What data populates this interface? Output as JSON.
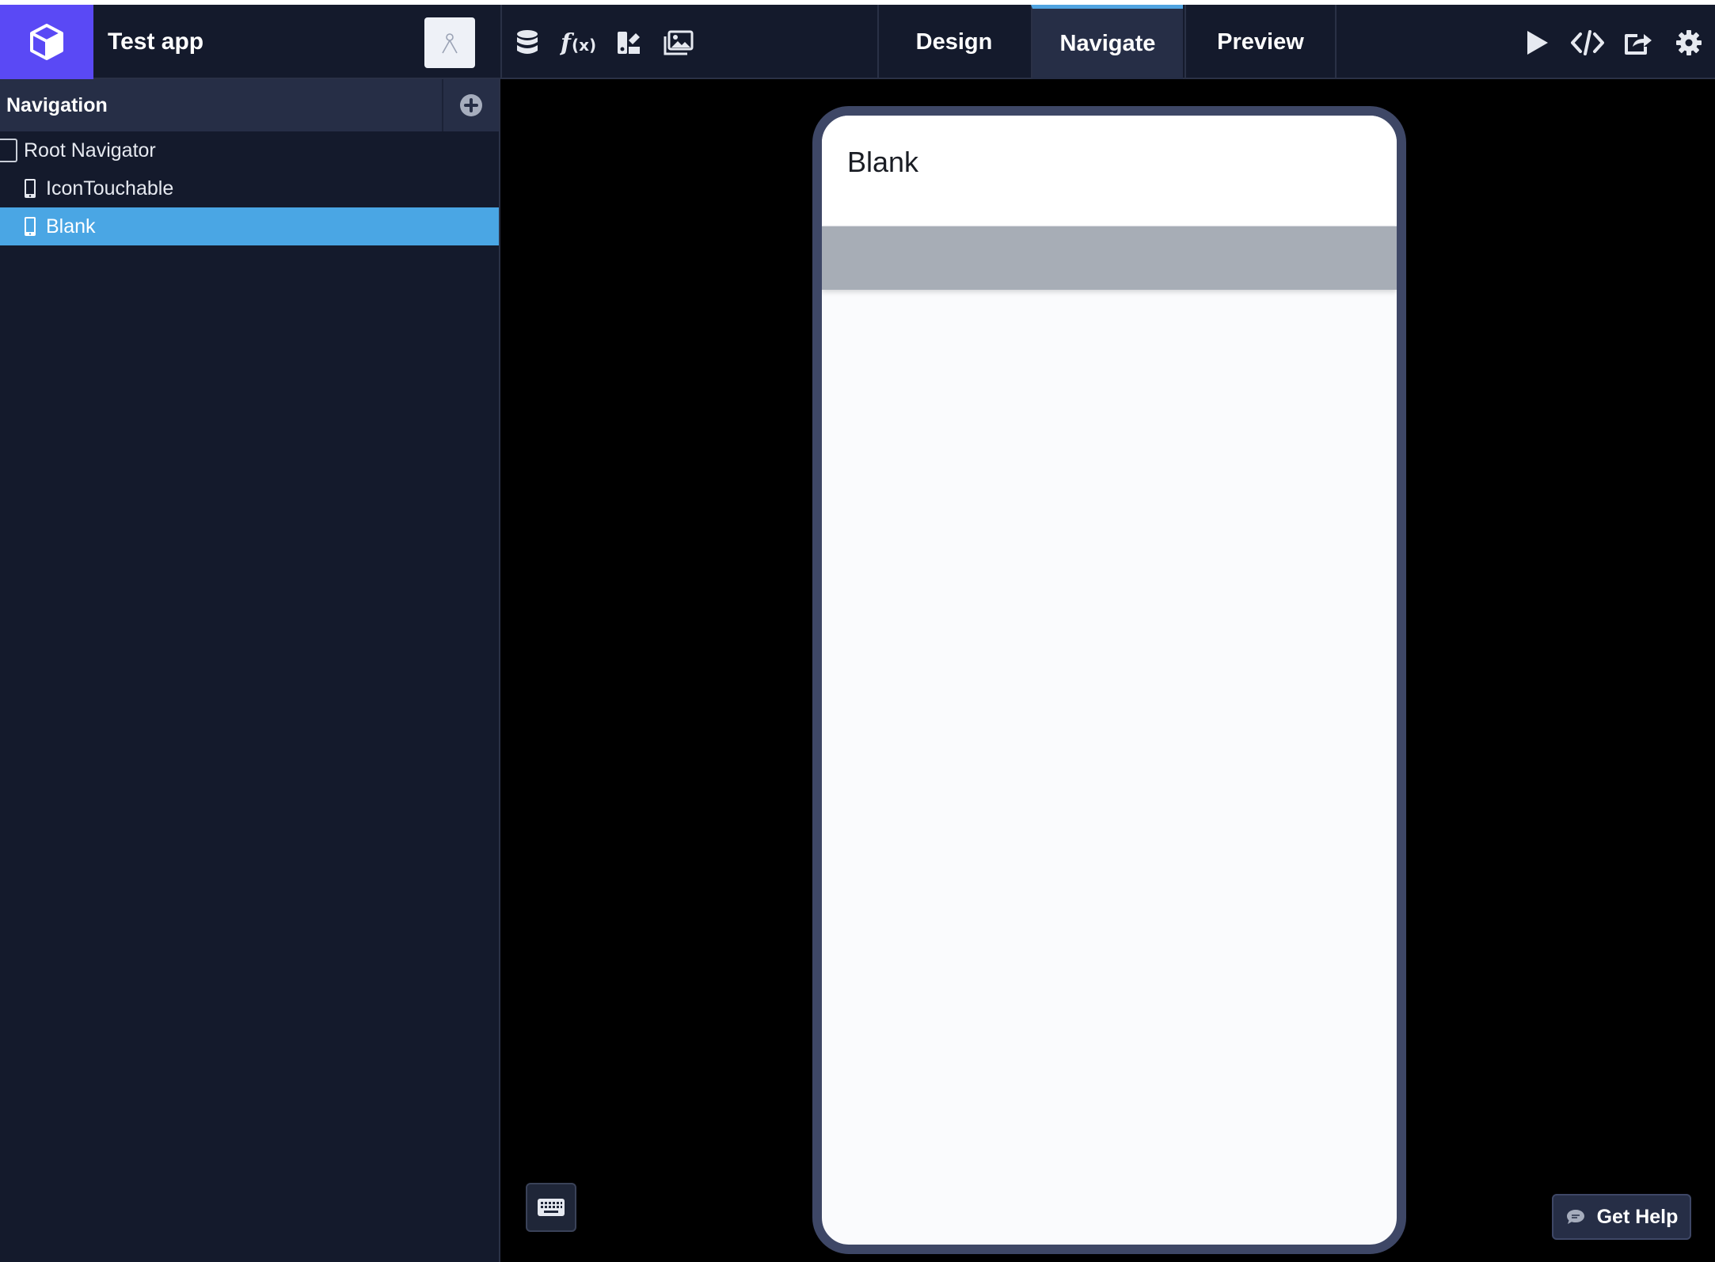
{
  "colors": {
    "brand": "#5a49f5",
    "header_bg": "#141a2c",
    "active_tab": "#262e46",
    "tab_accent": "#4fa3e0",
    "selected_row": "#4aa6e4",
    "canvas_bg": "#000000"
  },
  "header": {
    "logo_icon": "cube-icon",
    "app_title": "Test app",
    "user_icon": "user-avatar-icon",
    "tools": [
      {
        "name": "database-icon"
      },
      {
        "name": "function-icon"
      },
      {
        "name": "theme-icon"
      },
      {
        "name": "image-library-icon"
      }
    ],
    "tabs": [
      {
        "label": "Design",
        "active": false
      },
      {
        "label": "Navigate",
        "active": true
      },
      {
        "label": "Preview",
        "active": false
      }
    ],
    "actions": [
      "play-icon",
      "code-icon",
      "share-icon",
      "settings-icon"
    ]
  },
  "sidebar": {
    "title": "Navigation",
    "add_icon": "plus-circle-icon",
    "tree": [
      {
        "label": "Root Navigator",
        "level": 0,
        "selected": false,
        "icon": "navigator-icon"
      },
      {
        "label": "IconTouchable",
        "level": 1,
        "selected": false,
        "icon": "phone-icon"
      },
      {
        "label": "Blank",
        "level": 1,
        "selected": true,
        "icon": "phone-icon"
      }
    ]
  },
  "preview": {
    "screen_title": "Blank"
  },
  "help": {
    "label": "Get Help",
    "icon": "chat-bubble-icon"
  },
  "keyboard": {
    "icon": "keyboard-icon"
  }
}
